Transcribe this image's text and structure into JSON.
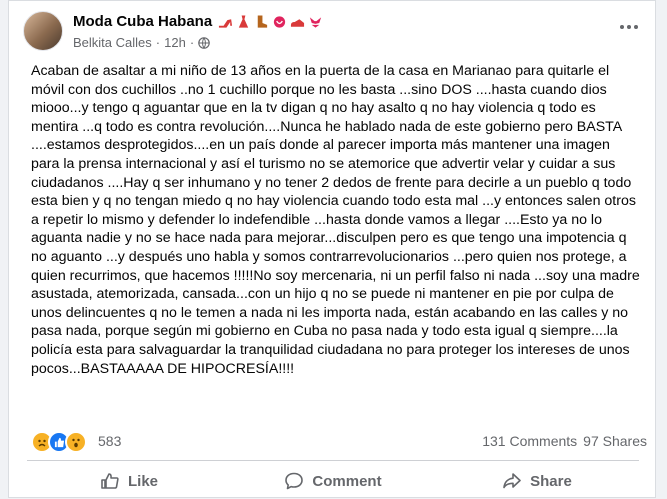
{
  "post": {
    "page_name": "Moda Cuba Habana",
    "name_emojis": [
      "high-heel-icon",
      "dress-icon",
      "boot-icon",
      "lipstick-icon",
      "sandal-icon",
      "bikini-icon"
    ],
    "author": "Belkita Calles",
    "separator": "·",
    "time": "12h",
    "separator2": "·",
    "visibility_icon": "globe-icon",
    "text": "Acaban de asaltar a mi niño de 13 años en la puerta de la casa en Marianao para quitarle el móvil con dos cuchillos ..no 1 cuchillo porque no les basta ...sino DOS ....hasta cuando dios miooo...y tengo q aguantar que en la tv digan q no hay asalto q no hay violencia q todo es mentira ...q todo es contra revolución....Nunca he hablado nada de este gobierno pero BASTA ....estamos desprotegidos....en un país donde al parecer importa más mantener una imagen para la prensa internacional y así el turismo no se atemorice que advertir velar y cuidar a sus ciudadanos ....Hay q ser inhumano y no tener 2 dedos de frente para decirle a un pueblo q todo esta bien y q no tengan miedo q no hay violencia cuando todo esta mal ...y entonces salen otros a repetir lo mismo y defender lo indefendible ...hasta donde vamos a llegar ....Esto ya no lo aguanta nadie y no se hace nada para mejorar...disculpen pero es que tengo una impotencia q no aguanto ...y después uno habla y somos contrarrevolucionarios ...pero quien nos protege, a quien recurrimos, que hacemos !!!!!No soy mercenaria, ni un perfil falso ni nada ...soy una madre asustada, atemorizada, cansada...con un hijo q no se puede ni mantener en pie por culpa de unos delincuentes q no le temen a nada ni les importa nada, están acabando en las calles y no pasa nada, porque según mi gobierno en Cuba no pasa nada y todo esta igual q siempre....la policía esta para salvaguardar la tranquilidad ciudadana no para proteger los intereses de unos pocos...BASTAAAAA DE HIPOCRESÍA!!!!"
  },
  "stats": {
    "reaction_icons": [
      "sad-reaction-icon",
      "like-reaction-icon",
      "wow-reaction-icon"
    ],
    "reaction_count": "583",
    "comments": "131 Comments",
    "shares": "97 Shares"
  },
  "actions": {
    "like": "Like",
    "comment": "Comment",
    "share": "Share"
  },
  "colors": {
    "text": "#050505",
    "secondary": "#65676b",
    "like_blue": "#1877f2",
    "reaction_yellow": "#f7b125",
    "divider": "#ced0d4",
    "emoji_red": "#e0245e"
  }
}
